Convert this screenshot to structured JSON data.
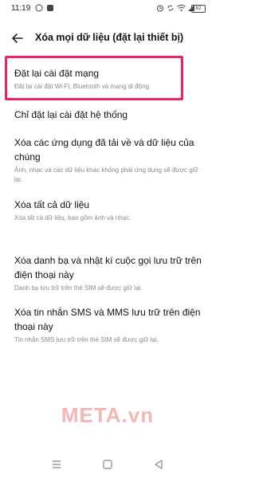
{
  "status": {
    "time": "11:19",
    "battery": "82"
  },
  "header": {
    "title": "Xóa mọi dữ liệu (đặt lại thiết bị)"
  },
  "items": [
    {
      "title": "Đặt lại cài đặt mạng",
      "desc": "Đặt lại cài đặt Wi-Fi, Bluetooth và mạng di động."
    },
    {
      "title": "Chỉ đặt lại cài đặt hệ thống",
      "desc": ""
    },
    {
      "title": "Xóa các ứng dụng đã tải về và dữ liệu của chúng",
      "desc": "Ảnh, nhạc và các dữ liệu khác không phải ứng dụng sẽ được giữ lại."
    },
    {
      "title": "Xóa tất cả dữ liệu",
      "desc": "Xóa tất cả dữ liệu, bao gồm ảnh và nhạc."
    },
    {
      "title": "Xóa danh bạ và nhật kí cuộc gọi lưu trữ trên điện thoại này",
      "desc": "Danh bạ lưu trữ trên thẻ SIM sẽ được giữ lại."
    },
    {
      "title": "Xóa tin nhắn SMS và MMS lưu trữ trên điện thoại này",
      "desc": "Tin nhắn SMS lưu trữ trên thẻ SIM sẽ được giữ lại."
    }
  ],
  "watermark": "META.vn",
  "colors": {
    "highlight": "#e8255c",
    "watermark": "#f5b6b6"
  }
}
